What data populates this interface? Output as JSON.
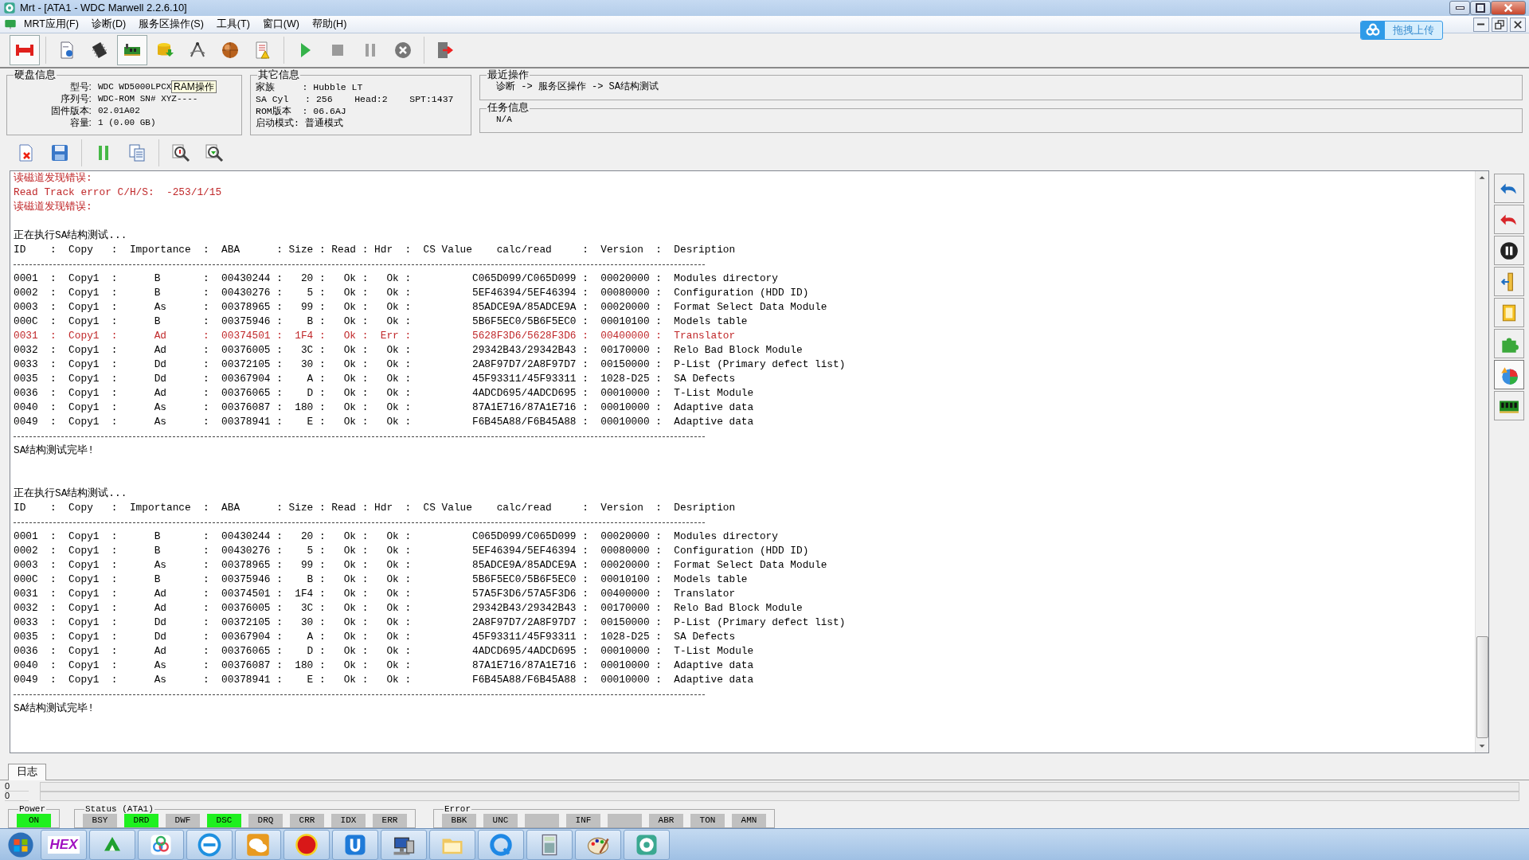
{
  "window": {
    "title": "Mrt - [ATA1 - WDC Marwell 2.2.6.10]"
  },
  "menu": [
    "MRT应用(F)",
    "诊断(D)",
    "服务区操作(S)",
    "工具(T)",
    "窗口(W)",
    "帮助(H)"
  ],
  "upload_button": {
    "label": "拖拽上传"
  },
  "tooltip": {
    "text": "RAM操作"
  },
  "disk_info": {
    "title": "硬盘信息",
    "fields": [
      {
        "label": "型号:",
        "value": "WDC WD5000LPCX"
      },
      {
        "label": "序列号:",
        "value": "WDC-ROM SN# XYZ----"
      },
      {
        "label": "固件版本:",
        "value": "02.01A02"
      },
      {
        "label": "容量:",
        "value": "1 (0.00 GB)"
      }
    ]
  },
  "other_info": {
    "title": "其它信息",
    "lines": [
      "家族     : Hubble LT",
      "SA Cyl   : 256    Head:2    SPT:1437",
      "ROM版本  : 06.6AJ",
      "启动模式: 普通模式"
    ]
  },
  "recent_ops": {
    "title": "最近操作",
    "text": "诊断 -> 服务区操作 -> SA结构测试"
  },
  "task_info": {
    "title": "任务信息",
    "text": "N/A"
  },
  "log": {
    "lines": [
      {
        "kind": "text",
        "error": true,
        "text": "读磁道发现错误:"
      },
      {
        "kind": "text",
        "error": true,
        "text": "Read Track error C/H/S:  -253/1/15"
      },
      {
        "kind": "text",
        "error": true,
        "text": "读磁道发现错误:"
      },
      {
        "kind": "blank"
      },
      {
        "kind": "text",
        "error": false,
        "text": "正在执行SA结构测试..."
      },
      {
        "kind": "text",
        "error": false,
        "text": "ID    :  Copy   :  Importance  :  ABA      : Size : Read : Hdr  :  CS Value    calc/read     :  Version  :  Desription"
      },
      {
        "kind": "rule"
      },
      {
        "kind": "text",
        "error": false,
        "text": "0001  :  Copy1  :      B       :  00430244 :   20 :   Ok :   Ok :          C065D099/C065D099 :  00020000 :  Modules directory"
      },
      {
        "kind": "text",
        "error": false,
        "text": "0002  :  Copy1  :      B       :  00430276 :    5 :   Ok :   Ok :          5EF46394/5EF46394 :  00080000 :  Configuration (HDD ID)"
      },
      {
        "kind": "text",
        "error": false,
        "text": "0003  :  Copy1  :      As      :  00378965 :   99 :   Ok :   Ok :          85ADCE9A/85ADCE9A :  00020000 :  Format Select Data Module"
      },
      {
        "kind": "text",
        "error": false,
        "text": "000C  :  Copy1  :      B       :  00375946 :    B :   Ok :   Ok :          5B6F5EC0/5B6F5EC0 :  00010100 :  Models table"
      },
      {
        "kind": "text",
        "error": true,
        "text": "0031  :  Copy1  :      Ad      :  00374501 :  1F4 :   Ok :  Err :          5628F3D6/5628F3D6 :  00400000 :  Translator"
      },
      {
        "kind": "text",
        "error": false,
        "text": "0032  :  Copy1  :      Ad      :  00376005 :   3C :   Ok :   Ok :          29342B43/29342B43 :  00170000 :  Relo Bad Block Module"
      },
      {
        "kind": "text",
        "error": false,
        "text": "0033  :  Copy1  :      Dd      :  00372105 :   30 :   Ok :   Ok :          2A8F97D7/2A8F97D7 :  00150000 :  P-List (Primary defect list)"
      },
      {
        "kind": "text",
        "error": false,
        "text": "0035  :  Copy1  :      Dd      :  00367904 :    A :   Ok :   Ok :          45F93311/45F93311 :  1028-D25 :  SA Defects"
      },
      {
        "kind": "text",
        "error": false,
        "text": "0036  :  Copy1  :      Ad      :  00376065 :    D :   Ok :   Ok :          4ADCD695/4ADCD695 :  00010000 :  T-List Module"
      },
      {
        "kind": "text",
        "error": false,
        "text": "0040  :  Copy1  :      As      :  00376087 :  180 :   Ok :   Ok :          87A1E716/87A1E716 :  00010000 :  Adaptive data"
      },
      {
        "kind": "text",
        "error": false,
        "text": "0049  :  Copy1  :      As      :  00378941 :    E :   Ok :   Ok :          F6B45A88/F6B45A88 :  00010000 :  Adaptive data"
      },
      {
        "kind": "rule"
      },
      {
        "kind": "text",
        "error": false,
        "text": "SA结构测试完毕!"
      },
      {
        "kind": "blank"
      },
      {
        "kind": "blank"
      },
      {
        "kind": "text",
        "error": false,
        "text": "正在执行SA结构测试..."
      },
      {
        "kind": "text",
        "error": false,
        "text": "ID    :  Copy   :  Importance  :  ABA      : Size : Read : Hdr  :  CS Value    calc/read     :  Version  :  Desription"
      },
      {
        "kind": "rule"
      },
      {
        "kind": "text",
        "error": false,
        "text": "0001  :  Copy1  :      B       :  00430244 :   20 :   Ok :   Ok :          C065D099/C065D099 :  00020000 :  Modules directory"
      },
      {
        "kind": "text",
        "error": false,
        "text": "0002  :  Copy1  :      B       :  00430276 :    5 :   Ok :   Ok :          5EF46394/5EF46394 :  00080000 :  Configuration (HDD ID)"
      },
      {
        "kind": "text",
        "error": false,
        "text": "0003  :  Copy1  :      As      :  00378965 :   99 :   Ok :   Ok :          85ADCE9A/85ADCE9A :  00020000 :  Format Select Data Module"
      },
      {
        "kind": "text",
        "error": false,
        "text": "000C  :  Copy1  :      B       :  00375946 :    B :   Ok :   Ok :          5B6F5EC0/5B6F5EC0 :  00010100 :  Models table"
      },
      {
        "kind": "text",
        "error": false,
        "text": "0031  :  Copy1  :      Ad      :  00374501 :  1F4 :   Ok :   Ok :          57A5F3D6/57A5F3D6 :  00400000 :  Translator"
      },
      {
        "kind": "text",
        "error": false,
        "text": "0032  :  Copy1  :      Ad      :  00376005 :   3C :   Ok :   Ok :          29342B43/29342B43 :  00170000 :  Relo Bad Block Module"
      },
      {
        "kind": "text",
        "error": false,
        "text": "0033  :  Copy1  :      Dd      :  00372105 :   30 :   Ok :   Ok :          2A8F97D7/2A8F97D7 :  00150000 :  P-List (Primary defect list)"
      },
      {
        "kind": "text",
        "error": false,
        "text": "0035  :  Copy1  :      Dd      :  00367904 :    A :   Ok :   Ok :          45F93311/45F93311 :  1028-D25 :  SA Defects"
      },
      {
        "kind": "text",
        "error": false,
        "text": "0036  :  Copy1  :      Ad      :  00376065 :    D :   Ok :   Ok :          4ADCD695/4ADCD695 :  00010000 :  T-List Module"
      },
      {
        "kind": "text",
        "error": false,
        "text": "0040  :  Copy1  :      As      :  00376087 :  180 :   Ok :   Ok :          87A1E716/87A1E716 :  00010000 :  Adaptive data"
      },
      {
        "kind": "text",
        "error": false,
        "text": "0049  :  Copy1  :      As      :  00378941 :    E :   Ok :   Ok :          F6B45A88/F6B45A88 :  00010000 :  Adaptive data"
      },
      {
        "kind": "rule"
      },
      {
        "kind": "text",
        "error": false,
        "text": "SA结构测试完毕!"
      }
    ]
  },
  "tabs": [
    {
      "label": "日志",
      "selected": true
    }
  ],
  "counters": [
    {
      "value": "0",
      "level": 0
    },
    {
      "value": "0",
      "level": 0
    }
  ],
  "power": {
    "title": "Power",
    "indicators": [
      {
        "label": "ON",
        "on": true
      }
    ]
  },
  "status": {
    "title": "Status (ATA1)",
    "indicators": [
      {
        "label": "BSY",
        "on": false
      },
      {
        "label": "DRD",
        "on": true
      },
      {
        "label": "DWF",
        "on": false
      },
      {
        "label": "DSC",
        "on": true
      },
      {
        "label": "DRQ",
        "on": false
      },
      {
        "label": "CRR",
        "on": false
      },
      {
        "label": "IDX",
        "on": false
      },
      {
        "label": "ERR",
        "on": false
      }
    ]
  },
  "error": {
    "title": "Error",
    "indicators": [
      {
        "label": "BBK",
        "on": false
      },
      {
        "label": "UNC",
        "on": false
      },
      {
        "on": false
      },
      {
        "label": "INF",
        "on": false
      },
      {
        "on": false
      },
      {
        "label": "ABR",
        "on": false
      },
      {
        "label": "TON",
        "on": false
      },
      {
        "label": "AMN",
        "on": false
      }
    ]
  },
  "taskbar": {
    "hex_label": "HEX"
  }
}
